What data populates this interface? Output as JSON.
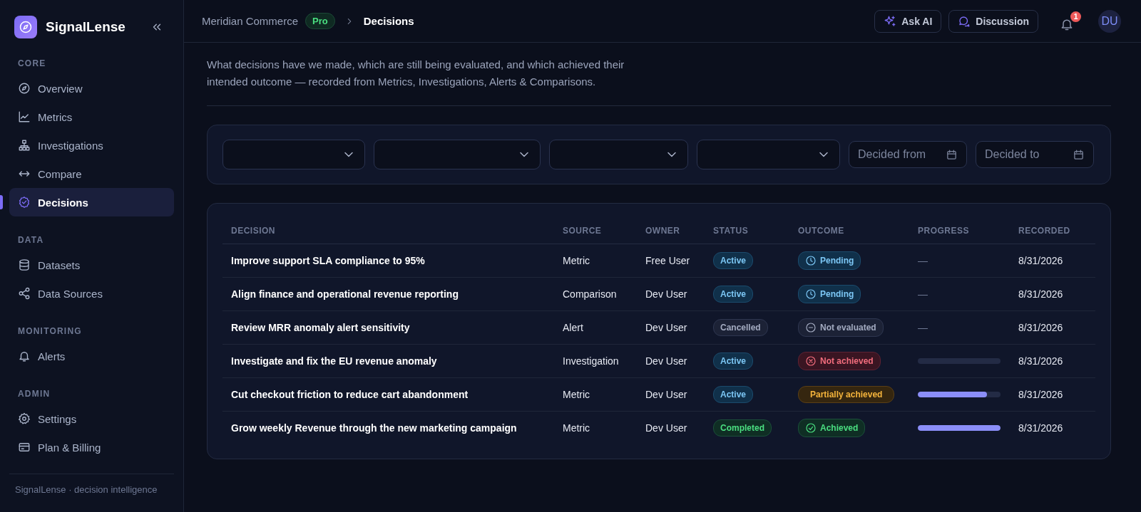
{
  "sidebar": {
    "brand": "SignalLense",
    "sections": [
      {
        "heading": "CORE",
        "items": [
          {
            "label": "Overview",
            "selected": false
          },
          {
            "label": "Metrics",
            "selected": false
          },
          {
            "label": "Investigations",
            "selected": false
          },
          {
            "label": "Compare",
            "selected": false
          },
          {
            "label": "Decisions",
            "selected": true
          }
        ]
      },
      {
        "heading": "DATA",
        "items": [
          {
            "label": "Datasets",
            "selected": false
          },
          {
            "label": "Data Sources",
            "selected": false
          }
        ]
      },
      {
        "heading": "MONITORING",
        "items": [
          {
            "label": "Alerts",
            "selected": false
          }
        ]
      },
      {
        "heading": "ADMIN",
        "items": [
          {
            "label": "Settings",
            "selected": false
          },
          {
            "label": "Plan & Billing",
            "selected": false
          }
        ]
      }
    ],
    "footer": "SignalLense · decision intelligence"
  },
  "header": {
    "breadcrumb": {
      "workspace": "Meridian Commerce",
      "plan": "Pro",
      "current": "Decisions"
    },
    "buttons": [
      {
        "label": "Ask AI"
      },
      {
        "label": "Discussion"
      }
    ],
    "notifications": "1",
    "avatar": "DU"
  },
  "page": {
    "subtitle": "What decisions have we made, which are still being evaluated, and which achieved their intended outcome — recorded from Metrics, Investigations, Alerts & Comparisons."
  },
  "filters": [
    {
      "kind": "select"
    },
    {
      "kind": "select"
    },
    {
      "kind": "select"
    },
    {
      "kind": "select"
    },
    {
      "kind": "date",
      "placeholder": "Decided from"
    },
    {
      "kind": "date",
      "placeholder": "Decided to"
    }
  ],
  "table": {
    "columns": [
      "DECISION",
      "SOURCE",
      "OWNER",
      "STATUS",
      "OUTCOME",
      "PROGRESS",
      "RECORDED"
    ],
    "rows": [
      {
        "decision": "Improve support SLA compliance to 95%",
        "source": "Metric",
        "owner": "Free User",
        "status": {
          "label": "Active",
          "kind": "active"
        },
        "outcome": {
          "label": "Pending",
          "kind": "pending"
        },
        "progress": {
          "kind": "text",
          "text": "—"
        },
        "recorded": "8/31/2026"
      },
      {
        "decision": "Align finance and operational revenue reporting",
        "source": "Comparison",
        "owner": "Dev User",
        "status": {
          "label": "Active",
          "kind": "active"
        },
        "outcome": {
          "label": "Pending",
          "kind": "pending"
        },
        "progress": {
          "kind": "text",
          "text": "—"
        },
        "recorded": "8/31/2026"
      },
      {
        "decision": "Review MRR anomaly alert sensitivity",
        "source": "Alert",
        "owner": "Dev User",
        "status": {
          "label": "Cancelled",
          "kind": "cancelled"
        },
        "outcome": {
          "label": "Not evaluated",
          "kind": "not_evaluated"
        },
        "progress": {
          "kind": "text",
          "text": "—"
        },
        "recorded": "8/31/2026"
      },
      {
        "decision": "Investigate and fix the EU revenue anomaly",
        "source": "Investigation",
        "owner": "Dev User",
        "status": {
          "label": "Active",
          "kind": "active"
        },
        "outcome": {
          "label": "Not achieved",
          "kind": "not_achieved"
        },
        "progress": {
          "kind": "bar",
          "level": 0
        },
        "recorded": "8/31/2026"
      },
      {
        "decision": "Cut checkout friction to reduce cart abandonment",
        "source": "Metric",
        "owner": "Dev User",
        "status": {
          "label": "Active",
          "kind": "active"
        },
        "outcome": {
          "label": "Partially achieved",
          "kind": "partial"
        },
        "progress": {
          "kind": "bar",
          "level": 0.84
        },
        "recorded": "8/31/2026"
      },
      {
        "decision": "Grow weekly Revenue through the new marketing campaign",
        "source": "Metric",
        "owner": "Dev User",
        "status": {
          "label": "Completed",
          "kind": "completed"
        },
        "outcome": {
          "label": "Achieved",
          "kind": "achieved"
        },
        "progress": {
          "kind": "bar",
          "level": 1
        },
        "recorded": "8/31/2026"
      }
    ]
  }
}
